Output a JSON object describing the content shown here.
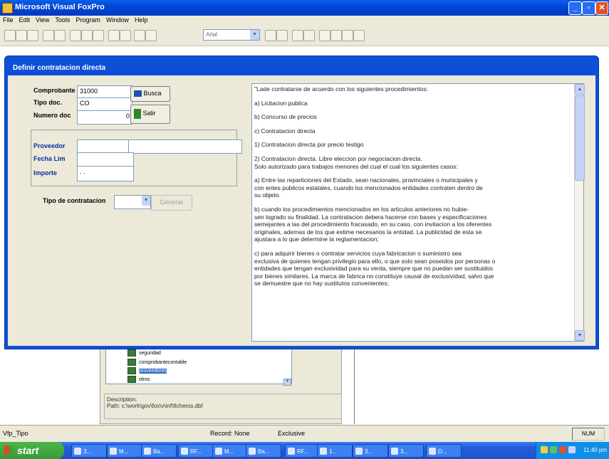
{
  "app": {
    "title": "Microsoft Visual FoxPro"
  },
  "menu": [
    "File",
    "Edit",
    "View",
    "Tools",
    "Program",
    "Window",
    "Help"
  ],
  "toolbar": {
    "font_value": "Arial"
  },
  "project": {
    "items": [
      {
        "label": "seguridad",
        "selected": false
      },
      {
        "label": "comprobantecontable",
        "selected": false
      },
      {
        "label": "proveedores",
        "selected": true
      },
      {
        "label": "otros",
        "selected": false
      }
    ],
    "description_label": "Description:",
    "description_path": "Path: c:\\work\\gov\\fox\\v\\inf\\ficheros.dbf"
  },
  "dialog": {
    "title": "Definir contratacion directa",
    "comprobante_label": "Comprobante",
    "comprobante_value": "31000",
    "tipodoc_label": "Tipo doc.",
    "tipodoc_value": "CO",
    "numero_label": "Numero doc",
    "numero_value": "0",
    "buscar_label": "Busca",
    "salir_label": "Salir",
    "proveedor_label": "Proveedor",
    "fecha_label": "Fecha Lim",
    "importe_label": "Importe",
    "importe_value": ". .",
    "tipo_contratacion_label": "Tipo de contratacion",
    "disabled_button_label": "Generar",
    "memo_paragraphs": [
      "\"Lade contratarse de acuerdo con los siguientes procedimientos:",
      "a) Licitacion publica",
      "b) Concurso de precios",
      "c) Contratacion directa",
      "1) Contratacion directa por precio testigo",
      "2) Contratacion directa. Libre eleccion por negociacion directa.\n   Solo autorizado para trabajos menores del cual el cual los siguientes casos:",
      "   a) Entre las reparticiones del Estado, sean nacionales, provinciales o municipales y\n   con entes publicos estatales, cuando los mencionados entidades contraten dentro de\n   su objeto.",
      "   b) cuando los procedimientos mencionados en los articulos anteriores no hubie-\n   sen logrado su finalidad. La contratacion debera hacerse con bases y especificaciones\n   semejantes a las del procedimiento fracasado, en su caso, con invitacion a los oferentes\n   originales, ademas de los que estime necesarios la entidad. La publicidad de esta se\n   ajustara a lo que determine la reglamentacion;",
      "   c) para adquirir bienes o contratar servicios cuya fabricacion o suministro sea\n   exclusiva de quienes tengan privilegio para ello, o que solo sean poseidos por personas o\n   entidades que tengan exclusividad para su venta, siempre que no puedan ser sustituidos\n   por bienes similares. La marca de fabrica no constituye causal de exclusividad, salvo que\n   se demuestre que no hay sustitutos convenientes;"
    ]
  },
  "status": {
    "left": "Vfp_Tipo",
    "record": "Record: None",
    "exclusive": "Exclusive",
    "mode": "NUM"
  },
  "taskbar": {
    "start_label": "start",
    "tasks": [
      "3...",
      "M...",
      "Ba...",
      "RF...",
      "M...",
      "Ba...",
      "RF...",
      "1...",
      "3...",
      "3...",
      "D..."
    ],
    "clock": "11:40 pm"
  },
  "colors": {
    "titlebar": "#0048d8",
    "dialog_frame": "#0f4fd8",
    "taskbar": "#245edc",
    "start": "#3a9b38"
  }
}
